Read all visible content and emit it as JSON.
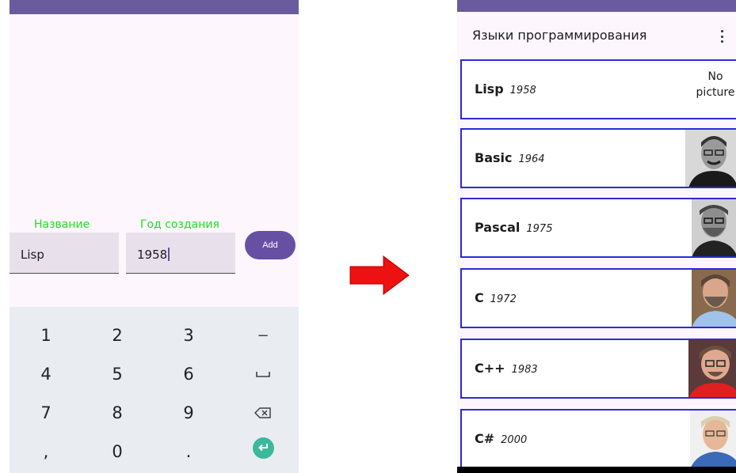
{
  "left_screen": {
    "form": {
      "name_label": "Название",
      "year_label": "Год создания",
      "name_value": "Lisp",
      "year_value": "1958",
      "add_label": "Add"
    },
    "keypad": {
      "keys": [
        "1",
        "2",
        "3",
        "−",
        "4",
        "5",
        "6",
        "␣",
        "7",
        "8",
        "9",
        "⌫",
        ",",
        "0",
        ".",
        "↵"
      ]
    }
  },
  "right_screen": {
    "app_title": "Языки программирования",
    "languages": [
      {
        "name": "Lisp",
        "year": "1958",
        "picture": "No picture"
      },
      {
        "name": "Basic",
        "year": "1964",
        "picture": "portrait"
      },
      {
        "name": "Pascal",
        "year": "1975",
        "picture": "portrait"
      },
      {
        "name": "C",
        "year": "1972",
        "picture": "portrait"
      },
      {
        "name": "C++",
        "year": "1983",
        "picture": "portrait"
      },
      {
        "name": "C#",
        "year": "2000",
        "picture": "portrait"
      }
    ]
  },
  "colors": {
    "accent": "#6750a4",
    "label_green": "#1ee01e",
    "card_border": "#2b2bd6",
    "arrow": "#ee1111"
  }
}
